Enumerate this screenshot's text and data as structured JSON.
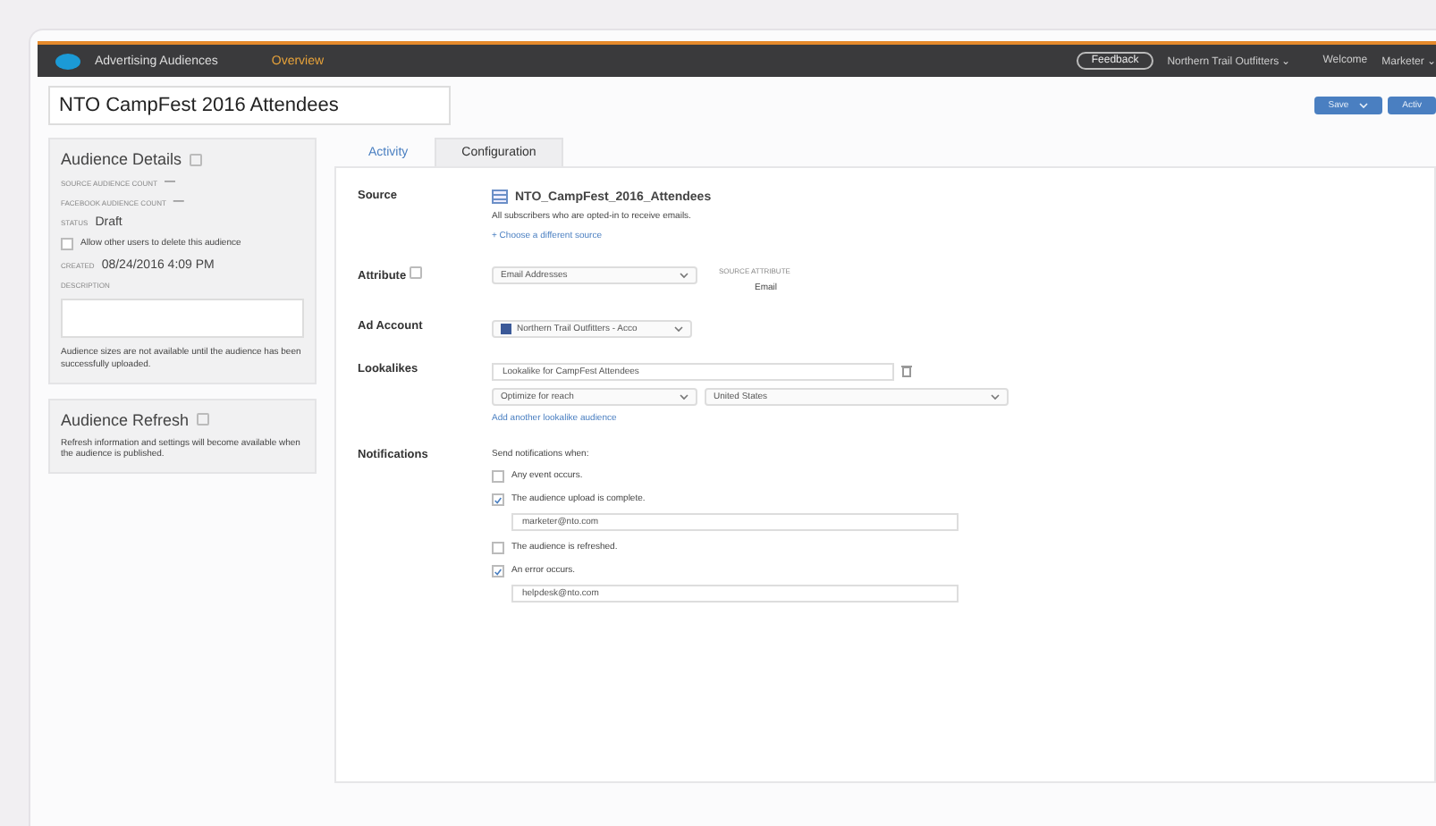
{
  "header": {
    "app_name": "Advertising Audiences",
    "nav_link": "Overview",
    "feedback": "Feedback",
    "account": "Northern Trail Outfitters ⌄",
    "welcome": "Welcome",
    "user": "Marketer ⌄"
  },
  "title": {
    "value": "NTO CampFest 2016 Attendees"
  },
  "actions": [
    {
      "label": "Save",
      "dropdown": true
    },
    {
      "label": "Activ",
      "dropdown": false
    }
  ],
  "details": {
    "heading": "Audience Details",
    "source_count_label": "SOURCE AUDIENCE COUNT",
    "source_count": "—",
    "facebook_count_label": "FACEBOOK AUDIENCE COUNT",
    "facebook_count": "—",
    "status_label": "STATUS",
    "status": "Draft",
    "allow_delete": {
      "label": "Allow other users to delete this audience",
      "checked": false
    },
    "created_label": "CREATED",
    "created": "08/24/2016 4:09 PM",
    "description_label": "DESCRIPTION",
    "note": "Audience sizes are not available until the audience has been successfully uploaded."
  },
  "refresh": {
    "heading": "Audience Refresh",
    "text": "Refresh information and settings will become available when the audience is published."
  },
  "tabs": [
    {
      "label": "Activity",
      "selected": false
    },
    {
      "label": "Configuration",
      "selected": true
    }
  ],
  "source": {
    "label": "Source",
    "name": "NTO_CampFest_2016_Attendees",
    "description": "All subscribers who are opted-in to receive emails.",
    "link": "+ Choose a different source"
  },
  "attribute": {
    "label": "Attribute",
    "select": "Email Addresses",
    "source_label": "SOURCE ATTRIBUTE",
    "source_value": "Email"
  },
  "ad_account": {
    "label": "Ad Account",
    "select": "Northern Trail Outfitters - Acco"
  },
  "lookalikes": {
    "label": "Lookalikes",
    "name": "Lookalike for CampFest Attendees",
    "optimize": "Optimize for reach",
    "country": "United States",
    "link": "Add another lookalike audience"
  },
  "notifications": {
    "label": "Notifications",
    "intro": "Send notifications when:",
    "options": [
      {
        "label": "Any event occurs.",
        "checked": false
      },
      {
        "label": "The audience upload is complete.",
        "checked": true,
        "email": "marketer@nto.com"
      },
      {
        "label": "The audience is refreshed.",
        "checked": false
      },
      {
        "label": "An error occurs.",
        "checked": true,
        "email": "helpdesk@nto.com"
      }
    ]
  }
}
